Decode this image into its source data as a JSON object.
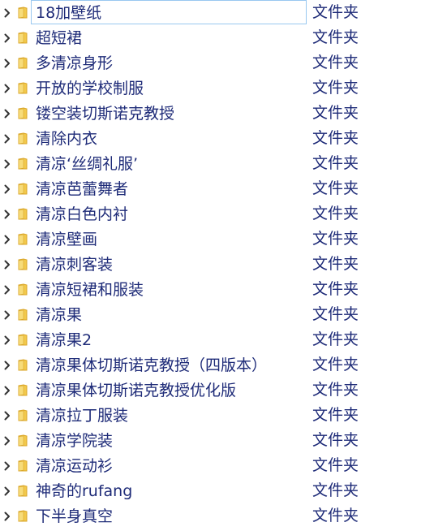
{
  "colors": {
    "text": "#1e2b78",
    "folder_fill": "#f2c94c",
    "folder_edge": "#d9a62a",
    "selection_border": "#99c8f0",
    "chevron": "#333333"
  },
  "icons": {
    "expand": "chevron-right-icon",
    "folder": "folder-icon"
  },
  "file_list": {
    "rows": [
      {
        "name": "18加壁纸",
        "type": "文件夹"
      },
      {
        "name": "超短裙",
        "type": "文件夹"
      },
      {
        "name": "多清凉身形",
        "type": "文件夹"
      },
      {
        "name": "开放的学校制服",
        "type": "文件夹"
      },
      {
        "name": "镂空装切斯诺克教授",
        "type": "文件夹"
      },
      {
        "name": "清除内衣",
        "type": "文件夹"
      },
      {
        "name": "清凉‘丝绸礼服’",
        "type": "文件夹"
      },
      {
        "name": "清凉芭蕾舞者",
        "type": "文件夹"
      },
      {
        "name": "清凉白色内衬",
        "type": "文件夹"
      },
      {
        "name": "清凉壁画",
        "type": "文件夹"
      },
      {
        "name": "清凉刺客装",
        "type": "文件夹"
      },
      {
        "name": "清凉短裙和服装",
        "type": "文件夹"
      },
      {
        "name": "清凉果",
        "type": "文件夹"
      },
      {
        "name": "清凉果2",
        "type": "文件夹"
      },
      {
        "name": "清凉果体切斯诺克教授（四版本）",
        "type": "文件夹"
      },
      {
        "name": "清凉果体切斯诺克教授优化版",
        "type": "文件夹"
      },
      {
        "name": "清凉拉丁服装",
        "type": "文件夹"
      },
      {
        "name": "清凉学院装",
        "type": "文件夹"
      },
      {
        "name": "清凉运动衫",
        "type": "文件夹"
      },
      {
        "name": "神奇的rufang",
        "type": "文件夹"
      },
      {
        "name": "下半身真空",
        "type": "文件夹"
      }
    ]
  }
}
